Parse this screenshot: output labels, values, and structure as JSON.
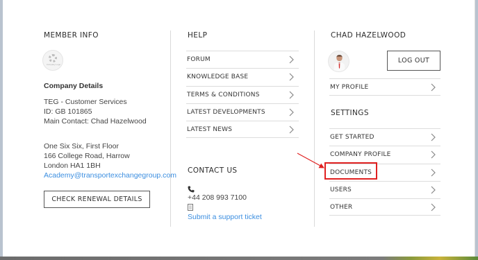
{
  "member_info": {
    "heading": "MEMBER INFO",
    "logo_caption": "Company Logo",
    "company_details_label": "Company Details",
    "company_name": "TEG - Customer Services",
    "company_id": "ID: GB 101865",
    "main_contact": "Main Contact: Chad Hazelwood",
    "address_line1": "One Six Six, First Floor",
    "address_line2": "166 College Road, Harrow",
    "address_line3": "London HA1 1BH",
    "email": "Academy@transportexchangegroup.com",
    "renewal_button": "CHECK RENEWAL DETAILS"
  },
  "help": {
    "heading": "HELP",
    "items": [
      {
        "label": "FORUM"
      },
      {
        "label": "KNOWLEDGE BASE"
      },
      {
        "label": "TERMS & CONDITIONS"
      },
      {
        "label": "LATEST DEVELOPMENTS"
      },
      {
        "label": "LATEST NEWS"
      }
    ]
  },
  "contact": {
    "heading": "CONTACT US",
    "phone": "+44 208 993 7100",
    "support_link": "Submit a support ticket"
  },
  "user": {
    "name": "CHAD HAZELWOOD",
    "logout_button": "LOG OUT",
    "profile_items": [
      {
        "label": "MY PROFILE"
      }
    ]
  },
  "settings": {
    "heading": "SETTINGS",
    "items": [
      {
        "label": "GET STARTED"
      },
      {
        "label": "COMPANY PROFILE"
      },
      {
        "label": "DOCUMENTS"
      },
      {
        "label": "USERS"
      },
      {
        "label": "OTHER"
      }
    ]
  },
  "colors": {
    "accent_link": "#3b8ee0",
    "annotation_red": "#e02020"
  },
  "icons": [
    "phone-icon",
    "document-icon",
    "chevron-right-icon",
    "gear-icon",
    "avatar"
  ]
}
